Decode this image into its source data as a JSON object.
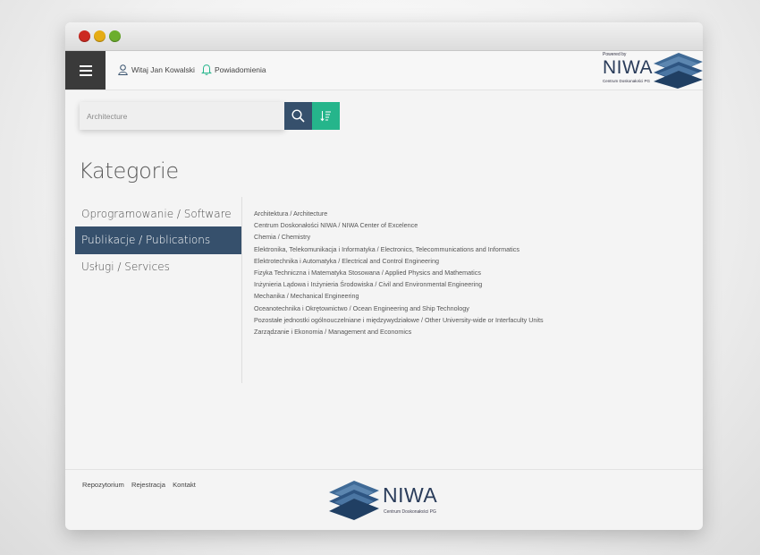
{
  "window": {
    "controls": [
      "close",
      "minimize",
      "maximize"
    ]
  },
  "header": {
    "menu_icon": "hamburger-icon",
    "user_icon": "user-icon",
    "user_greeting": "Witaj Jan Kowalski",
    "notifications_icon": "bell-icon",
    "notifications_label": "Powiadomienia"
  },
  "logo_top": {
    "powered_by": "Powered by",
    "brand": "NIWA",
    "subtitle": "Centrum Doskonałości PG"
  },
  "search": {
    "placeholder": "Architecture",
    "search_icon": "search-icon",
    "sort_icon": "sort-icon"
  },
  "page": {
    "title": "Kategorie"
  },
  "categories": [
    {
      "label": "Oprogramowanie / Software",
      "active": false
    },
    {
      "label": "Publikacje / Publications",
      "active": true
    },
    {
      "label": "Usługi / Services",
      "active": false
    }
  ],
  "subcategories": [
    "Architektura / Architecture",
    "Centrum Doskonałości NIWA / NIWA Center of Excelence",
    "Chemia / Chemistry",
    "Elektronika, Telekomunikacja i Informatyka / Electronics, Telecommunications and Informatics",
    "Elektrotechnika i Automatyka / Electrical and Control Engineering",
    "Fizyka Techniczna i Matematyka Stosowana / Applied Physics and Mathematics",
    "Inżynieria Lądowa i Inżynieria Środowiska / Civil and Environmental Engineering",
    "Mechanika / Mechanical Engineering",
    "Oceanotechnika i Okrętownictwo / Ocean Engineering and Ship Technology",
    "Pozostałe jednostki ogólnouczelniane i międzywydziałowe / Other University-wide or Interfaculty Units",
    "Zarządzanie i Ekonomia / Management and Economics"
  ],
  "footer": {
    "links": [
      "Repozytorium",
      "Rejestracja",
      "Kontakt"
    ],
    "brand": "NIWA",
    "subtitle": "Centrum Doskonałości PG"
  },
  "colors": {
    "accent_dark": "#36506c",
    "accent_green": "#25b58b",
    "menu_bg": "#3a3a3a",
    "brand": "#2a3c5a"
  }
}
